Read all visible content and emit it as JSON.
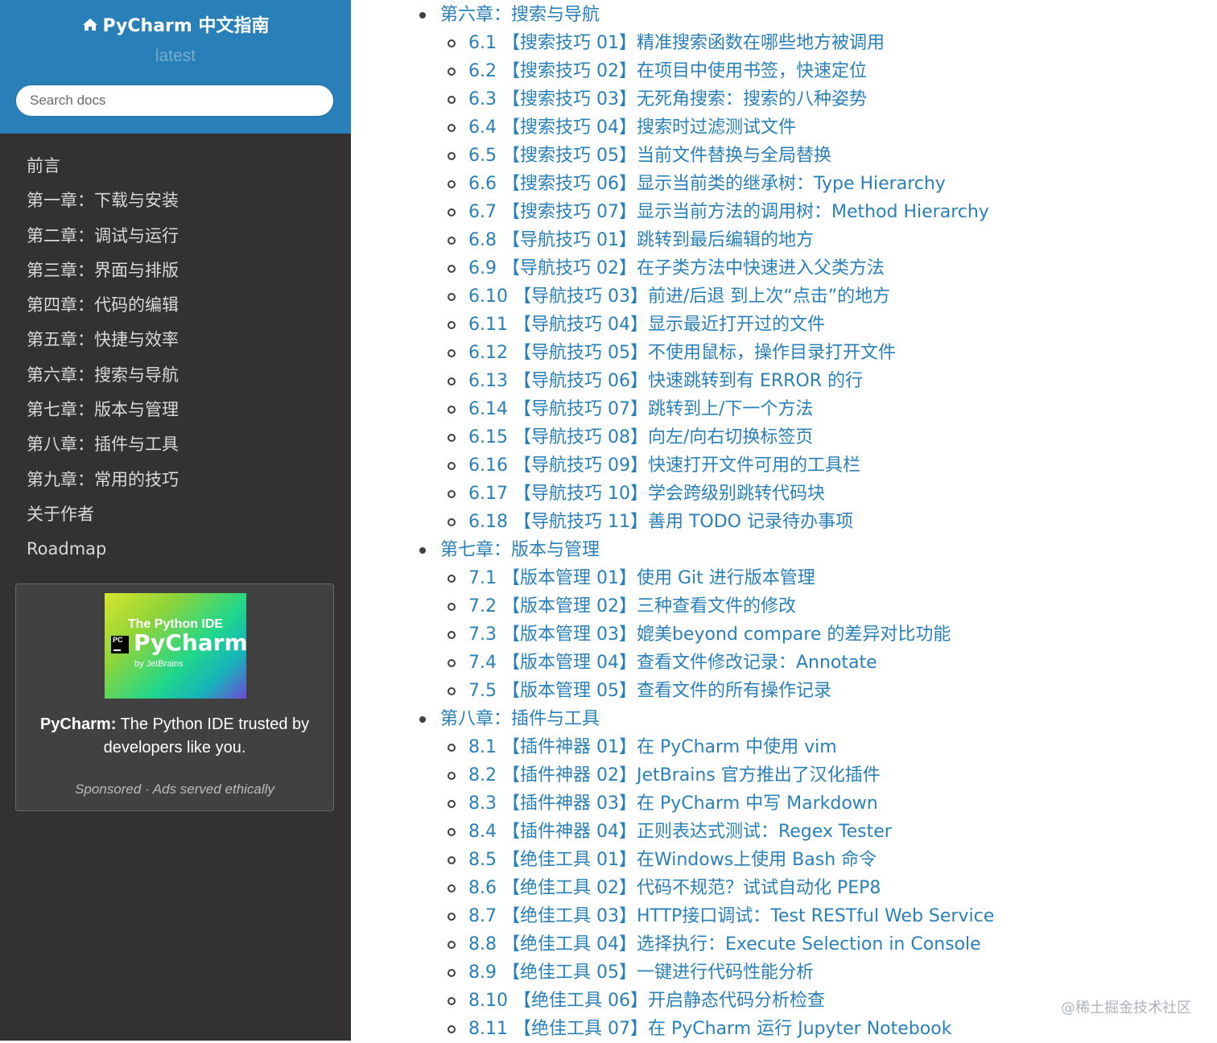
{
  "sidebar": {
    "brand": "PyCharm 中文指南",
    "version": "latest",
    "search_placeholder": "Search docs",
    "nav": [
      "前言",
      "第一章：下载与安装",
      "第二章：调试与运行",
      "第三章：界面与排版",
      "第四章：代码的编辑",
      "第五章：快捷与效率",
      "第六章：搜索与导航",
      "第七章：版本与管理",
      "第八章：插件与工具",
      "第九章：常用的技巧",
      "关于作者",
      "Roadmap"
    ],
    "ad": {
      "image_line1": "The Python IDE",
      "image_badge": "PC",
      "image_line2": "PyCharm",
      "image_line3": "by JetBrains",
      "text_bold": "PyCharm:",
      "text": "The Python IDE trusted by developers like you.",
      "footer": "Sponsored · Ads served ethically"
    }
  },
  "toc": [
    {
      "level": 1,
      "text": "第六章：搜索与导航"
    },
    {
      "level": 2,
      "text": "6.1 【搜索技巧 01】精准搜索函数在哪些地方被调用"
    },
    {
      "level": 2,
      "text": "6.2 【搜索技巧 02】在项目中使用书签，快速定位"
    },
    {
      "level": 2,
      "text": "6.3 【搜索技巧 03】无死角搜索：搜索的八种姿势"
    },
    {
      "level": 2,
      "text": "6.4 【搜索技巧 04】搜索时过滤测试文件"
    },
    {
      "level": 2,
      "text": "6.5 【搜索技巧 05】当前文件替换与全局替换"
    },
    {
      "level": 2,
      "text": "6.6 【搜索技巧 06】显示当前类的继承树：Type Hierarchy"
    },
    {
      "level": 2,
      "text": "6.7 【搜索技巧 07】显示当前方法的调用树：Method Hierarchy"
    },
    {
      "level": 2,
      "text": "6.8 【导航技巧 01】跳转到最后编辑的地方"
    },
    {
      "level": 2,
      "text": "6.9 【导航技巧 02】在子类方法中快速进入父类方法"
    },
    {
      "level": 2,
      "text": "6.10 【导航技巧 03】前进/后退 到上次“点击”的地方"
    },
    {
      "level": 2,
      "text": "6.11 【导航技巧 04】显示最近打开过的文件"
    },
    {
      "level": 2,
      "text": "6.12 【导航技巧 05】不使用鼠标，操作目录打开文件"
    },
    {
      "level": 2,
      "text": "6.13 【导航技巧 06】快速跳转到有 ERROR 的行"
    },
    {
      "level": 2,
      "text": "6.14 【导航技巧 07】跳转到上/下一个方法"
    },
    {
      "level": 2,
      "text": "6.15 【导航技巧 08】向左/向右切换标签页"
    },
    {
      "level": 2,
      "text": "6.16 【导航技巧 09】快速打开文件可用的工具栏"
    },
    {
      "level": 2,
      "text": "6.17 【导航技巧 10】学会跨级别跳转代码块"
    },
    {
      "level": 2,
      "text": "6.18 【导航技巧 11】善用 TODO 记录待办事项"
    },
    {
      "level": 1,
      "text": "第七章：版本与管理"
    },
    {
      "level": 2,
      "text": "7.1 【版本管理 01】使用 Git 进行版本管理"
    },
    {
      "level": 2,
      "text": "7.2 【版本管理 02】三种查看文件的修改"
    },
    {
      "level": 2,
      "text": "7.3 【版本管理 03】媲美beyond compare 的差异对比功能"
    },
    {
      "level": 2,
      "text": "7.4 【版本管理 04】查看文件修改记录：Annotate"
    },
    {
      "level": 2,
      "text": "7.5 【版本管理 05】查看文件的所有操作记录"
    },
    {
      "level": 1,
      "text": "第八章：插件与工具"
    },
    {
      "level": 2,
      "text": "8.1 【插件神器 01】在 PyCharm 中使用 vim"
    },
    {
      "level": 2,
      "text": "8.2 【插件神器 02】JetBrains 官方推出了汉化插件"
    },
    {
      "level": 2,
      "text": "8.3 【插件神器 03】在 PyCharm 中写 Markdown"
    },
    {
      "level": 2,
      "text": "8.4 【插件神器 04】正则表达式测试：Regex Tester"
    },
    {
      "level": 2,
      "text": "8.5 【绝佳工具 01】在Windows上使用 Bash 命令"
    },
    {
      "level": 2,
      "text": "8.6 【绝佳工具 02】代码不规范？试试自动化 PEP8"
    },
    {
      "level": 2,
      "text": "8.7 【绝佳工具 03】HTTP接口调试：Test RESTful Web Service"
    },
    {
      "level": 2,
      "text": "8.8 【绝佳工具 04】选择执行：Execute Selection in Console"
    },
    {
      "level": 2,
      "text": "8.9 【绝佳工具 05】一键进行代码性能分析"
    },
    {
      "level": 2,
      "text": "8.10 【绝佳工具 06】开启静态代码分析检查"
    },
    {
      "level": 2,
      "text": "8.11 【绝佳工具 07】在 PyCharm 运行 Jupyter Notebook"
    }
  ],
  "watermark": "@稀土掘金技术社区",
  "colors": {
    "sidebar_bg": "#343131",
    "header_bg": "#2980b9",
    "link": "#2980b9"
  },
  "icons": {
    "brand": "home-icon"
  }
}
